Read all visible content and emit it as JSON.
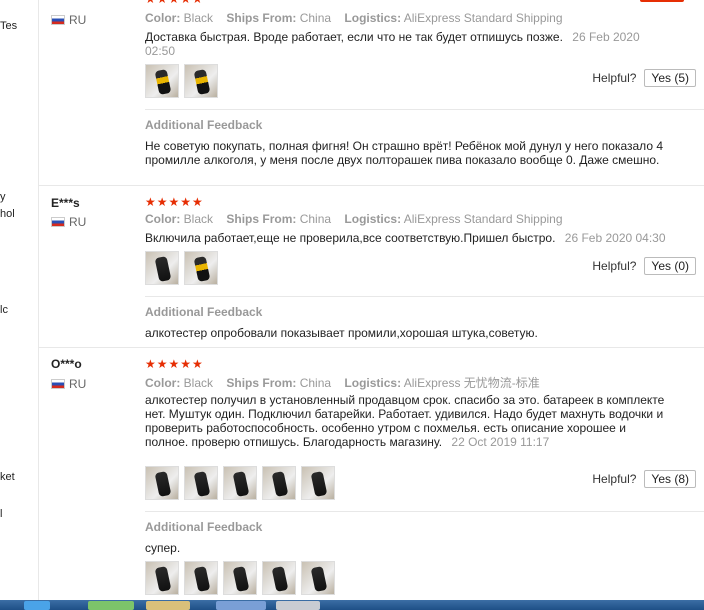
{
  "gutter": [
    "Tes",
    "y",
    "hol",
    "lc",
    "ket",
    "l"
  ],
  "meta_labels": {
    "color": "Color:",
    "ships_from": "Ships From:",
    "logistics": "Logistics:"
  },
  "helpful_label": "Helpful?",
  "additional_feedback_label": "Additional Feedback",
  "stars": "★★★★★",
  "reviews": [
    {
      "user": "",
      "country": "RU",
      "color": "Black",
      "ships_from": "China",
      "logistics": "AliExpress Standard Shipping",
      "text": "Доставка быстрая. Вроде работает, если что не так будет отпишусь позже.",
      "date": "26 Feb 2020 02:50",
      "helpful": "Yes (5)",
      "additional_feedback": "Не советую покупать, полная фигня! Он страшно врёт! Ребёнок мой дунул у него показало 4 промилле алкоголя, у меня после двух полторашек пива показало вообще 0. Даже смешно."
    },
    {
      "user": "E***s",
      "country": "RU",
      "color": "Black",
      "ships_from": "China",
      "logistics": "AliExpress Standard Shipping",
      "text": "Включила работает,еще не проверила,все соответствую.Пришел быстро.",
      "date": "26 Feb 2020 04:30",
      "helpful": "Yes (0)",
      "additional_feedback": "алкотестер опробовали показывает промили,хорошая штука,советую."
    },
    {
      "user": "O***o",
      "country": "RU",
      "color": "Black",
      "ships_from": "China",
      "logistics": "AliExpress 无忧物流-标准",
      "text": "алкотестер получил в установленный продавцом срок. спасибо за это. батареек в комплекте нет. Муштук один. Подключил батарейки. Работает. удивился. Надо будет махнуть водочки и проверить работоспособность. особенно утром с похмелья. есть описание хорошее и полное. проверю отпишусь. Благодарность магазину.",
      "date": "22 Oct 2019 11:17",
      "helpful": "Yes (8)",
      "additional_feedback": "супер."
    }
  ]
}
